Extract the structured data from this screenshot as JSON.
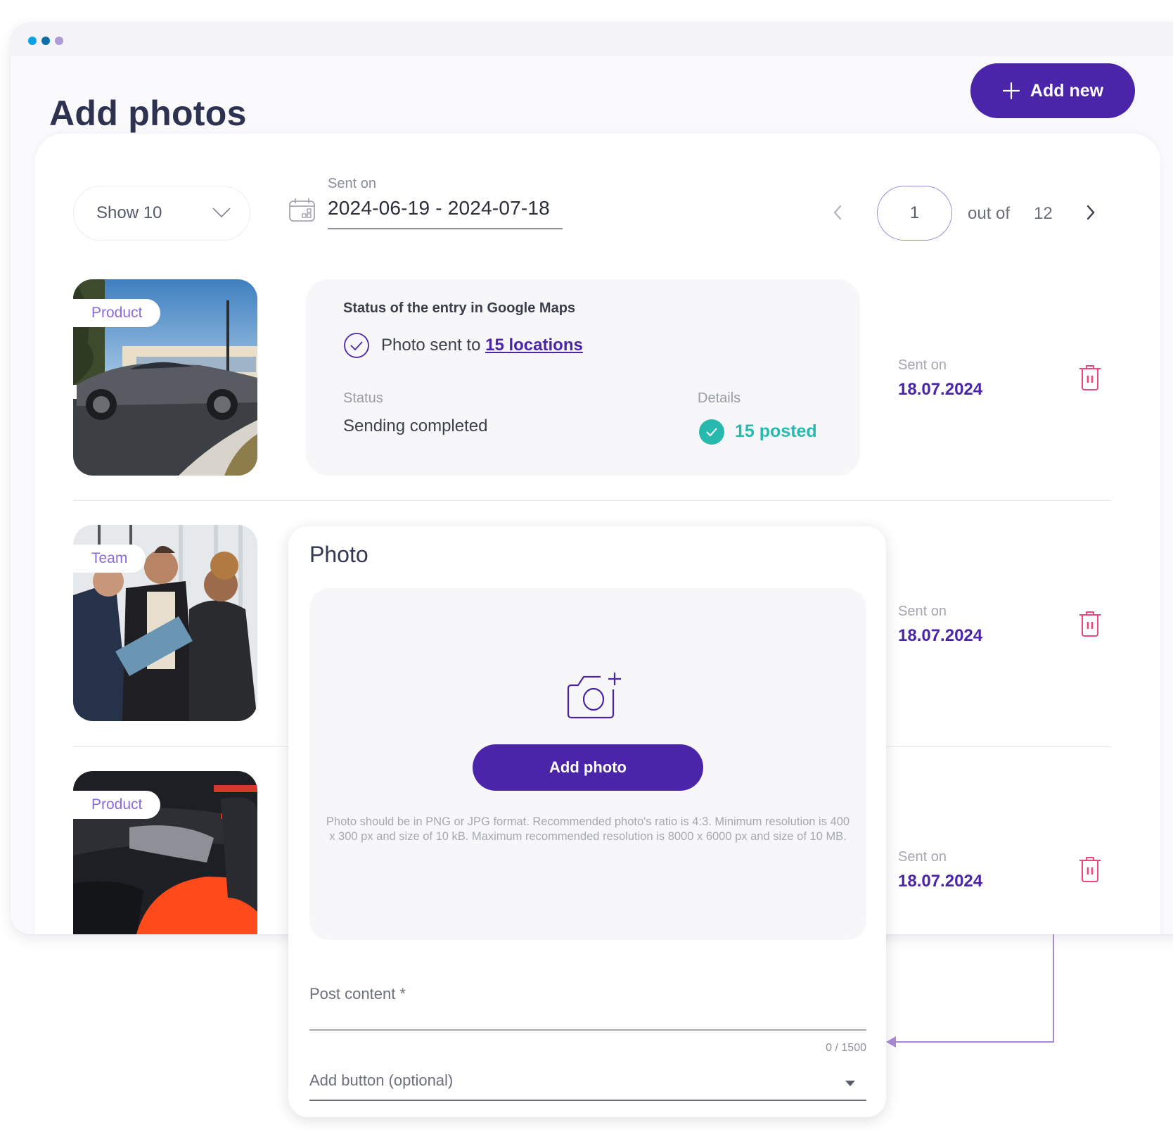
{
  "window": {
    "dots": [
      "#0aa0e6",
      "#0a6fa6",
      "#ae9ad8"
    ]
  },
  "header": {
    "title": "Add photos",
    "add_new_label": "Add new"
  },
  "toolbar": {
    "show_select_value": "Show 10",
    "date_filter_label": "Sent on",
    "date_filter_value": "2024-06-19 - 2024-07-18",
    "pagination": {
      "current_page": "1",
      "out_of_label": "out of",
      "total_pages": "12"
    }
  },
  "rows": [
    {
      "tag": "Product",
      "image": "car-exterior-photo",
      "sent_label": "Sent on",
      "sent_date": "18.07.2024",
      "status_card": {
        "title": "Status of the entry in Google Maps",
        "sent_prefix": "Photo sent to",
        "sent_link": "15 locations",
        "status_label": "Status",
        "status_value": "Sending completed",
        "details_label": "Details",
        "details_value": "15 posted"
      }
    },
    {
      "tag": "Team",
      "image": "team-meeting-photo",
      "sent_label": "Sent on",
      "sent_date": "18.07.2024"
    },
    {
      "tag": "Product",
      "image": "car-interior-photo",
      "sent_label": "Sent on",
      "sent_date": "18.07.2024"
    }
  ],
  "photo_modal": {
    "title": "Photo",
    "add_photo_label": "Add photo",
    "hint": "Photo should be in PNG or JPG format. Recommended photo's ratio is 4:3. Minimum resolution is 400 x 300 px and size of 10 kB. Maximum recommended resolution is 8000 x 6000 px and size of 10 MB.",
    "post_content_label": "Post content *",
    "post_content_value": "",
    "post_content_counter": "0 / 1500",
    "add_button_label": "Add button (optional)"
  },
  "colors": {
    "brand": "#4a25aa",
    "success": "#27b9ae",
    "danger": "#f0467a",
    "tag_text": "#8a6ad8",
    "connector": "#a98ad8"
  }
}
